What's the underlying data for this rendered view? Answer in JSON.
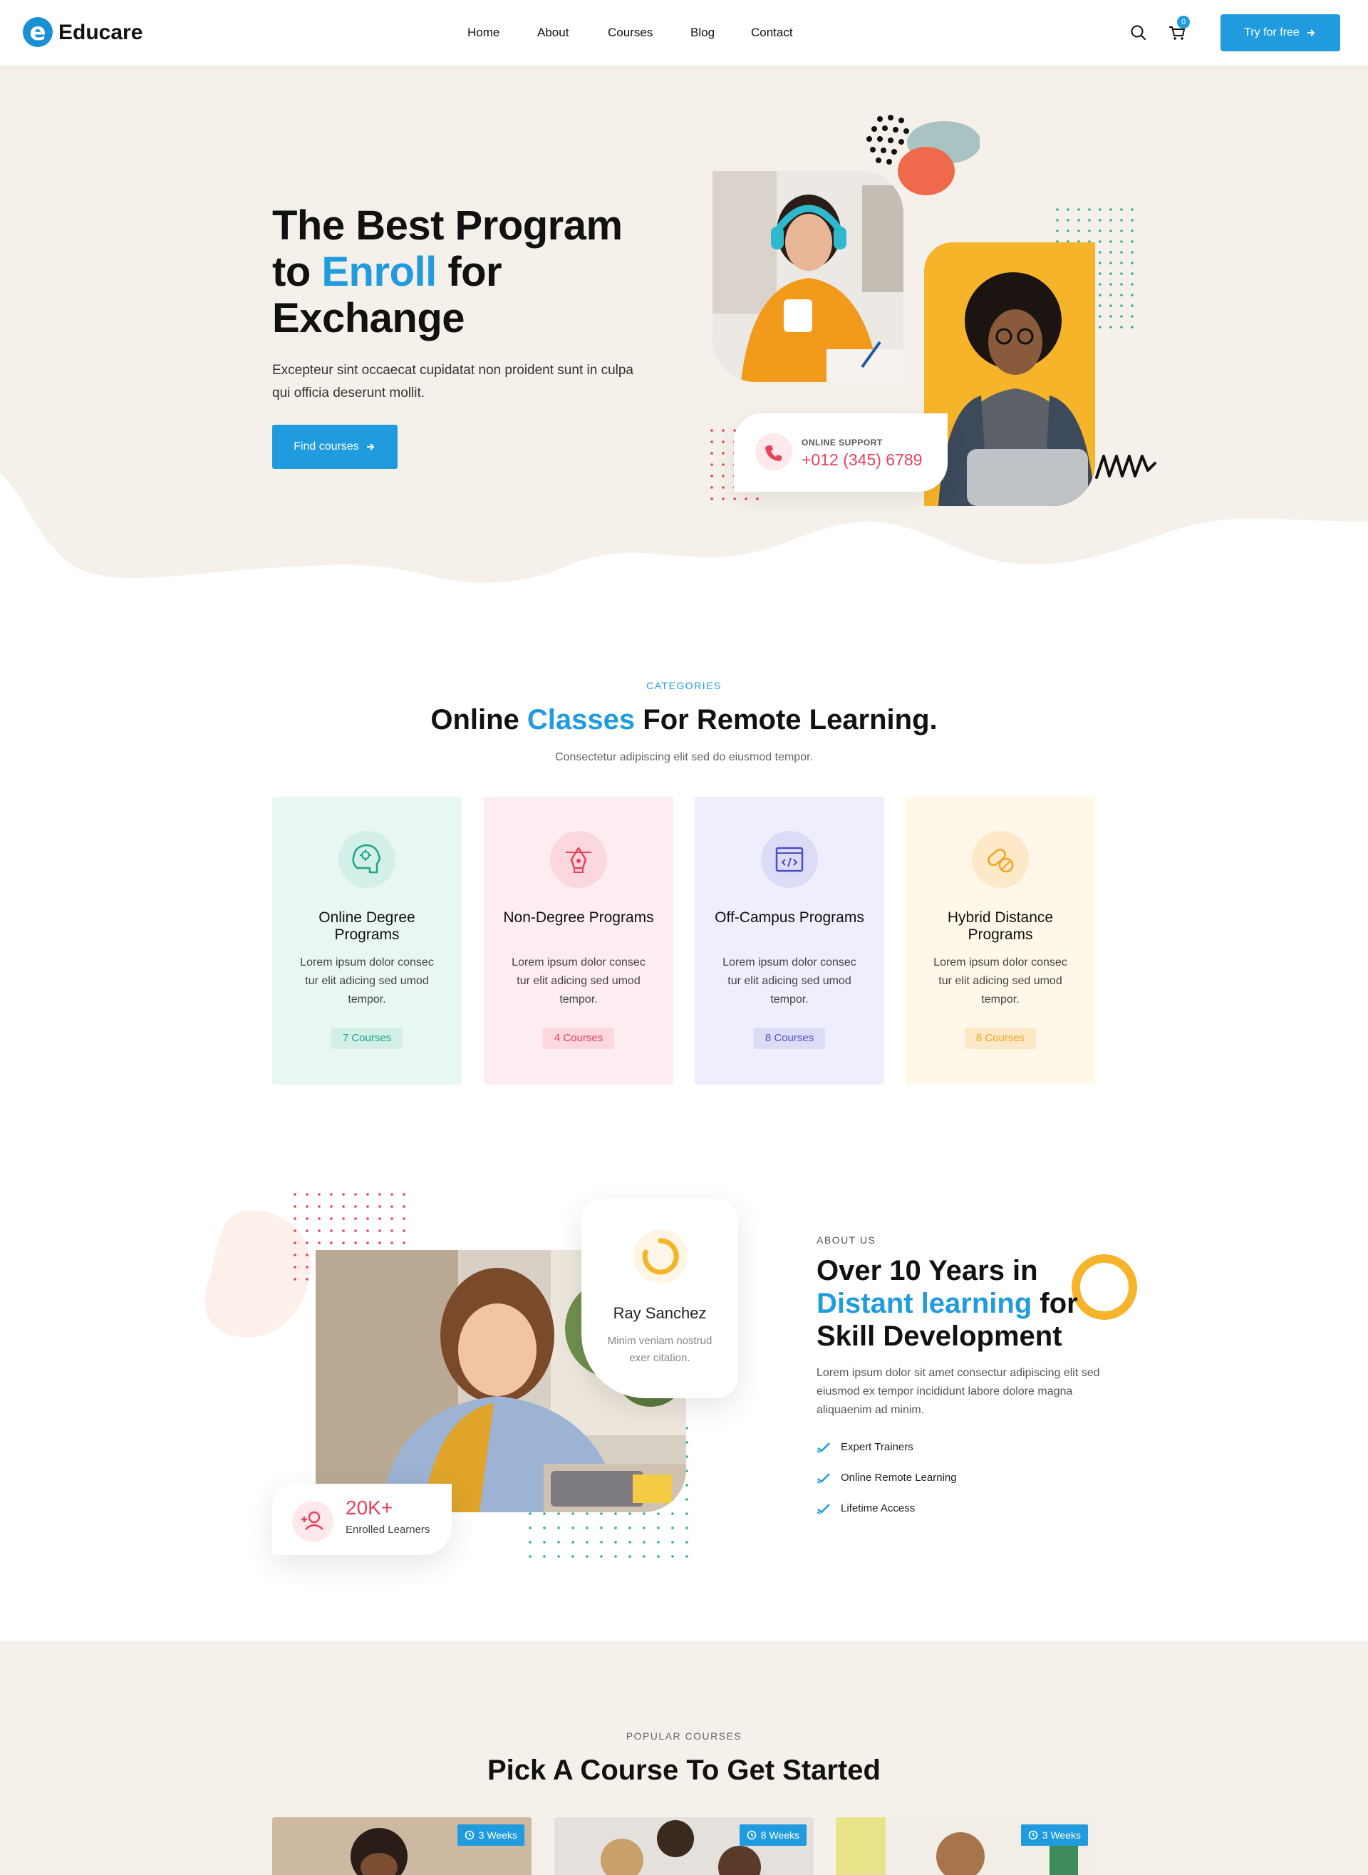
{
  "header": {
    "logo_mark": "e",
    "logo_text": "Educare",
    "nav": [
      "Home",
      "About",
      "Courses",
      "Blog",
      "Contact"
    ],
    "cart_count": "0",
    "try_button": "Try for free",
    "icons": [
      "search-icon",
      "cart-icon",
      "arrow-right-icon"
    ]
  },
  "hero": {
    "title_line1": "The Best Program",
    "title_to": "to ",
    "title_highlight": "Enroll",
    "title_for": " for",
    "title_line3": "Exchange",
    "description": "Excepteur sint occaecat cupidatat non proident sunt in culpa qui officia deserunt mollit.",
    "button": "Find courses",
    "support_label": "ONLINE SUPPORT",
    "support_phone": "+012 (345) 6789"
  },
  "categories": {
    "eyebrow": "CATEGORIES",
    "title_pre": "Online ",
    "title_highlight": "Classes",
    "title_post": " For Remote Learning.",
    "subtitle": "Consectetur adipiscing elit sed do eiusmod tempor.",
    "cards": [
      {
        "title": "Online Degree Programs",
        "desc": "Lorem ipsum dolor consec tur elit adicing sed umod tempor.",
        "badge": "7 Courses",
        "bg": "#e9f7f4",
        "icon_bg": "#d2efe8",
        "accent": "#1fa488",
        "icon": "brain-icon"
      },
      {
        "title": "Non-Degree Programs",
        "desc": "Lorem ipsum dolor consec tur elit adicing sed umod tempor.",
        "badge": "4 Courses",
        "bg": "#fdedf0",
        "icon_bg": "#fbd8de",
        "accent": "#e8415b",
        "icon": "pen-tool-icon"
      },
      {
        "title": "Off-Campus Programs",
        "desc": "Lorem ipsum dolor consec tur elit adicing sed umod tempor.",
        "badge": "8 Courses",
        "bg": "#eeeefc",
        "icon_bg": "#dcdcf7",
        "accent": "#4a4fc4",
        "icon": "code-window-icon"
      },
      {
        "title": "Hybrid Distance Programs",
        "desc": "Lorem ipsum dolor consec tur elit adicing sed umod tempor.",
        "badge": "8 Courses",
        "bg": "#fff7e8",
        "icon_bg": "#fde9c8",
        "accent": "#f4a31c",
        "icon": "pills-icon"
      }
    ]
  },
  "about": {
    "eyebrow": "ABOUT US",
    "title_line1": "Over 10 Years in",
    "title_highlight": "Distant learning",
    "title_for": " for",
    "title_line3": "Skill Development",
    "description": "Lorem ipsum dolor sit amet consectur adipiscing elit sed eiusmod ex tempor incididunt labore dolore magna aliquaenim ad minim.",
    "checklist": [
      "Expert Trainers",
      "Online Remote Learning",
      "Lifetime Access"
    ],
    "instructor_name": "Ray Sanchez",
    "instructor_desc": "Minim veniam nostrud exer citation.",
    "enrolled_value": "20K+",
    "enrolled_label": "Enrolled Learners"
  },
  "popular": {
    "eyebrow": "POPULAR COURSES",
    "title": "Pick A Course To Get Started",
    "cards": [
      {
        "badge": "3 Weeks"
      },
      {
        "badge": "8 Weeks"
      },
      {
        "badge": "3 Weeks"
      }
    ]
  },
  "colors": {
    "primary": "#1f9bde",
    "hero_bg": "#f5f1ea",
    "accent_red": "#e8415b",
    "accent_yellow": "#f6b42a"
  }
}
